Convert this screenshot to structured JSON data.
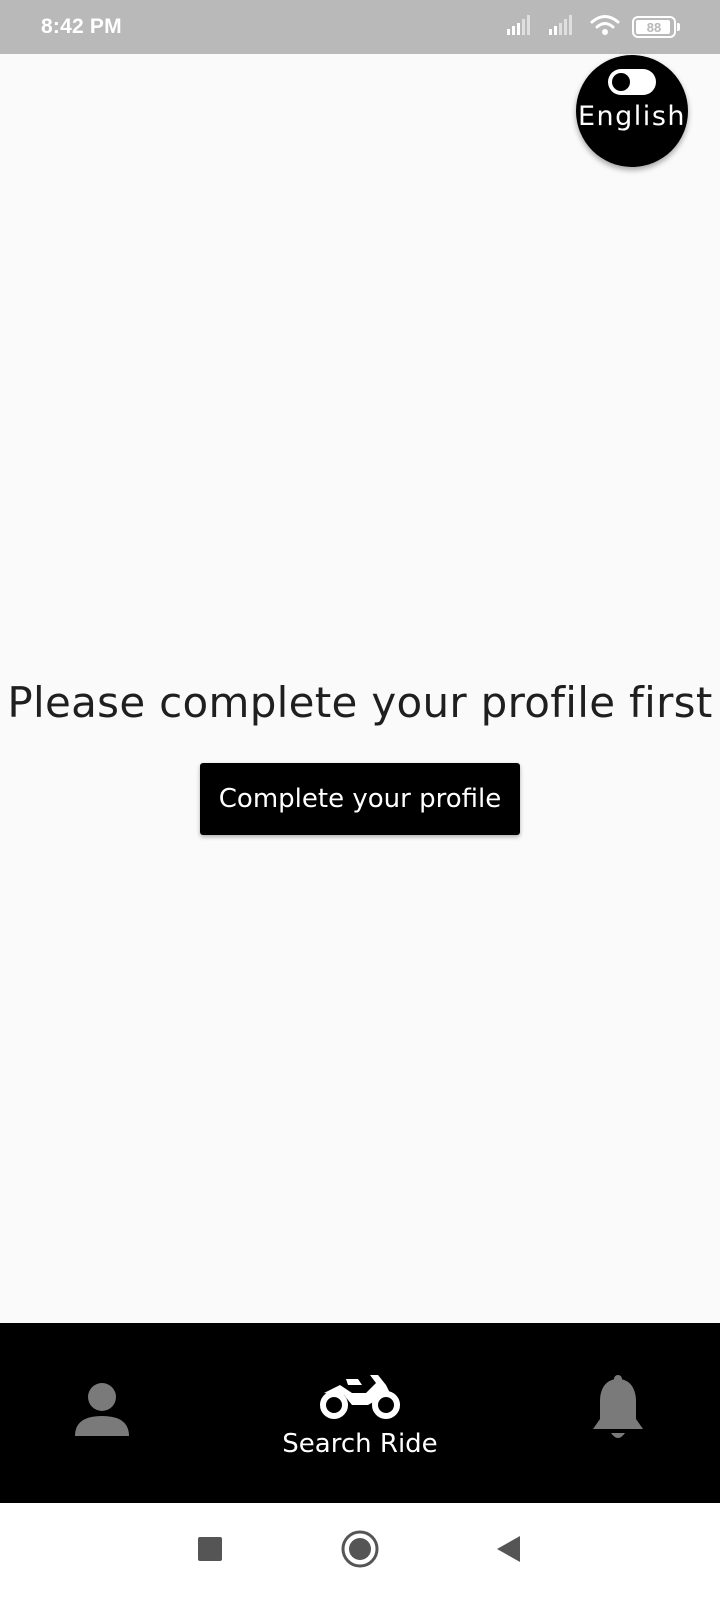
{
  "status_bar": {
    "time": "8:42 PM",
    "battery_level": "88",
    "icons": [
      "signal-icon",
      "signal-icon",
      "wifi-icon",
      "battery-icon"
    ]
  },
  "language_toggle": {
    "label": "English",
    "icon": "toggle-icon"
  },
  "main": {
    "message": "Please complete your profile first",
    "button_label": "Complete your profile"
  },
  "bottom_nav": {
    "items": [
      {
        "icon": "person-icon",
        "label": "",
        "active": false
      },
      {
        "icon": "motorcycle-icon",
        "label": "Search Ride",
        "active": true
      },
      {
        "icon": "bell-icon",
        "label": "",
        "active": false
      }
    ]
  },
  "system_nav": {
    "icons": [
      "recents-square-icon",
      "home-circle-icon",
      "back-triangle-icon"
    ]
  },
  "colors": {
    "status_bar_bg": "#b9b9b9",
    "page_bg": "#fafafa",
    "primary": "#000000",
    "inactive_icon": "#7a7a7a",
    "active_icon": "#ffffff"
  }
}
